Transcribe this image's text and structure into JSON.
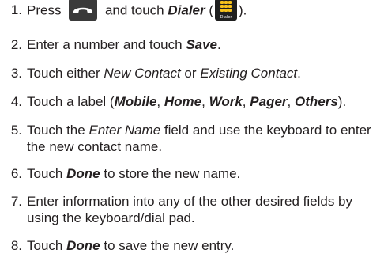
{
  "steps": [
    {
      "number": "1.",
      "parts": {
        "a": "Press",
        "b": "and touch",
        "c": "Dialer",
        "d": "(",
        "e": ")."
      },
      "dialer_icon_caption": "Dialer",
      "talk_icon": "phone-handset-icon",
      "dialer_icon": "dialpad-icon"
    },
    {
      "number": "2.",
      "parts": {
        "a": "Enter a number and touch",
        "b": "Save",
        "c": "."
      }
    },
    {
      "number": "3.",
      "parts": {
        "a": "Touch either",
        "b": "New Contact",
        "c": "or",
        "d": "Existing Contact",
        "e": "."
      }
    },
    {
      "number": "4.",
      "parts": {
        "a": "Touch a label (",
        "b": "Mobile",
        "c": ",",
        "d": "Home",
        "e": ",",
        "f": "Work",
        "g": ",",
        "h": "Pager",
        "i": ",",
        "j": "Others",
        "k": ")."
      }
    },
    {
      "number": "5.",
      "parts": {
        "a": "Touch the",
        "b": "Enter Name",
        "c": "field and use the keyboard to enter the new contact name."
      }
    },
    {
      "number": "6.",
      "parts": {
        "a": "Touch",
        "b": "Done",
        "c": "to store the new name."
      }
    },
    {
      "number": "7.",
      "parts": {
        "a": "Enter information into any of the other desired fields by using the keyboard/dial pad."
      }
    },
    {
      "number": "8.",
      "parts": {
        "a": "Touch",
        "b": "Done",
        "c": "to save the new entry."
      }
    }
  ],
  "colors": {
    "text": "#231f20",
    "talk_button": "#3a3a3a",
    "dialer_icon_bg": "#1f1f1f",
    "dialer_icon_keys": "#f7c21b"
  }
}
